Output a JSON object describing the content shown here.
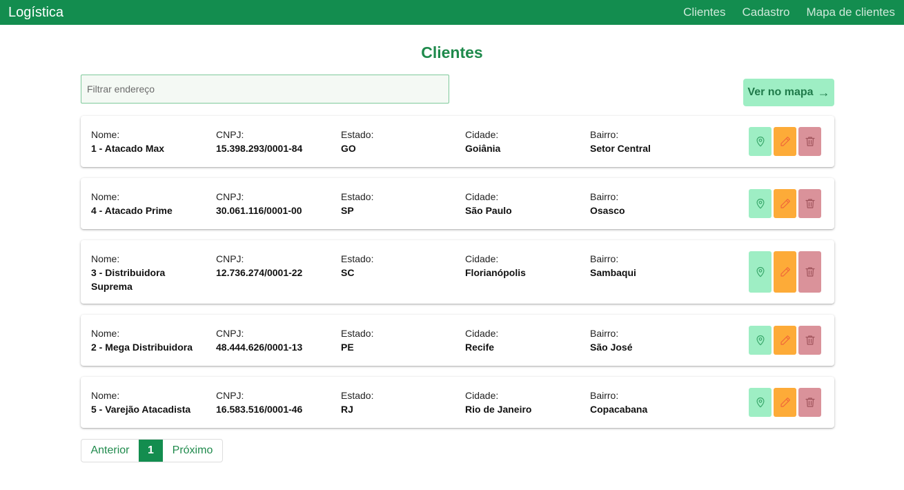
{
  "navbar": {
    "brand": "Logística",
    "links": [
      "Clientes",
      "Cadastro",
      "Mapa de clientes"
    ]
  },
  "page_title": "Clientes",
  "filter": {
    "placeholder": "Filtrar endereço",
    "value": ""
  },
  "map_button": {
    "label": "Ver no mapa",
    "arrow": "→"
  },
  "labels": {
    "nome": "Nome:",
    "cnpj": "CNPJ:",
    "estado": "Estado:",
    "cidade": "Cidade:",
    "bairro": "Bairro:"
  },
  "clients": [
    {
      "nome": "1 - Atacado Max",
      "cnpj": "15.398.293/0001-84",
      "estado": "GO",
      "cidade": "Goiânia",
      "bairro": "Setor Central"
    },
    {
      "nome": "4 - Atacado Prime",
      "cnpj": "30.061.116/0001-00",
      "estado": "SP",
      "cidade": "São Paulo",
      "bairro": "Osasco"
    },
    {
      "nome": "3 - Distribuidora Suprema",
      "cnpj": "12.736.274/0001-22",
      "estado": "SC",
      "cidade": "Florianópolis",
      "bairro": "Sambaqui"
    },
    {
      "nome": "2 - Mega Distribuidora",
      "cnpj": "48.444.626/0001-13",
      "estado": "PE",
      "cidade": "Recife",
      "bairro": "São José"
    },
    {
      "nome": "5 - Varejão Atacadista",
      "cnpj": "16.583.516/0001-46",
      "estado": "RJ",
      "cidade": "Rio de Janeiro",
      "bairro": "Copacabana"
    }
  ],
  "actions": [
    {
      "name": "location",
      "icon": "map-pin-icon",
      "color": "#3aa86b"
    },
    {
      "name": "edit",
      "icon": "pencil-icon",
      "color": "#f0663a"
    },
    {
      "name": "delete",
      "icon": "trash-icon",
      "color": "#a0545c"
    }
  ],
  "pagination": {
    "prev": "Anterior",
    "current": "1",
    "next": "Próximo"
  },
  "colors": {
    "primary": "#138d4f",
    "title": "#1f8a4c",
    "location_bg": "#9eeec4",
    "edit_bg": "#fdab38",
    "delete_bg": "#da929a"
  }
}
